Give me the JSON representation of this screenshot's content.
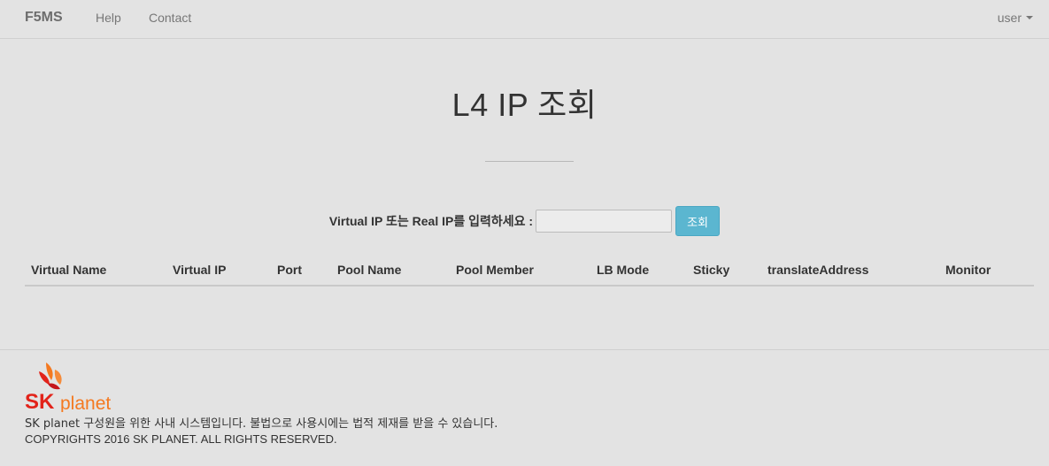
{
  "navbar": {
    "brand": "F5MS",
    "links": [
      "Help",
      "Contact"
    ],
    "user_label": "user"
  },
  "page_title": "L4 IP 조회",
  "search": {
    "label": "Virtual IP 또는 Real IP를 입력하세요 :",
    "input_value": "",
    "button_label": "조회"
  },
  "table": {
    "columns": [
      "Virtual Name",
      "Virtual IP",
      "Port",
      "Pool Name",
      "Pool Member",
      "LB Mode",
      "Sticky",
      "translateAddress",
      "Monitor"
    ],
    "rows": []
  },
  "footer": {
    "logo_text": "SK planet",
    "notice": "SK planet 구성원을 위한 사내 시스템입니다. 불법으로 사용시에는 법적 제재를 받을 수 있습니다.",
    "copyright": "COPYRIGHTS 2016 SK PLANET. ALL RIGHTS RESERVED."
  },
  "colors": {
    "background": "#e3e3e3",
    "button_accent": "#5bb6d0",
    "logo_red": "#e2231a",
    "logo_orange": "#f47920"
  },
  "icons": [
    "caret-down-icon"
  ]
}
